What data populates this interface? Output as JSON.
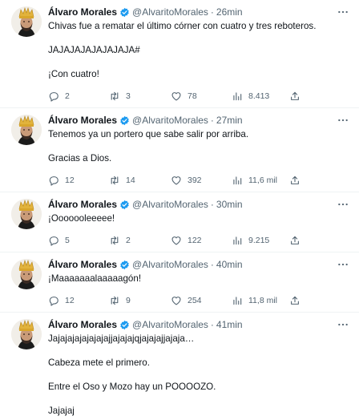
{
  "tweets": [
    {
      "name": "Álvaro Morales",
      "handle": "@AlvaritoMorales",
      "dot": "·",
      "time": "26min",
      "lines": [
        "Chivas fue a rematar el último córner con cuatro y tres reboteros.",
        "",
        "JAJAJAJAJAJAJAJA#",
        "",
        "¡Con cuatro!"
      ],
      "replies": "2",
      "retweets": "3",
      "likes": "78",
      "views": "8.413"
    },
    {
      "name": "Álvaro Morales",
      "handle": "@AlvaritoMorales",
      "dot": "·",
      "time": "27min",
      "lines": [
        "Tenemos ya un portero que sabe salir por arriba.",
        "",
        "Gracias a Dios."
      ],
      "replies": "12",
      "retweets": "14",
      "likes": "392",
      "views": "11,6 mil"
    },
    {
      "name": "Álvaro Morales",
      "handle": "@AlvaritoMorales",
      "dot": "·",
      "time": "30min",
      "lines": [
        "¡Ooooooleeeee!"
      ],
      "replies": "5",
      "retweets": "2",
      "likes": "122",
      "views": "9.215"
    },
    {
      "name": "Álvaro Morales",
      "handle": "@AlvaritoMorales",
      "dot": "·",
      "time": "40min",
      "lines": [
        "¡Maaaaaaalaaaaagón!"
      ],
      "replies": "12",
      "retweets": "9",
      "likes": "254",
      "views": "11,8 mil"
    },
    {
      "name": "Álvaro Morales",
      "handle": "@AlvaritoMorales",
      "dot": "·",
      "time": "41min",
      "lines": [
        "Jajajajajajajajajjajajajqjajajajjajaja…",
        "",
        "Cabeza mete el primero.",
        "",
        "Entre el Oso y Mozo hay un POOOOZO.",
        "",
        "Jajajaj"
      ],
      "replies": "",
      "retweets": "",
      "likes": "",
      "views": ""
    }
  ],
  "icons": {
    "verified": "verified-badge-icon",
    "more": "more-icon",
    "reply": "reply-icon",
    "retweet": "retweet-icon",
    "like": "like-icon",
    "views": "views-icon",
    "share": "share-icon"
  },
  "colors": {
    "text": "#0f1419",
    "secondary": "#536471",
    "verified": "#1d9bf0",
    "divider": "#eff3f4"
  }
}
